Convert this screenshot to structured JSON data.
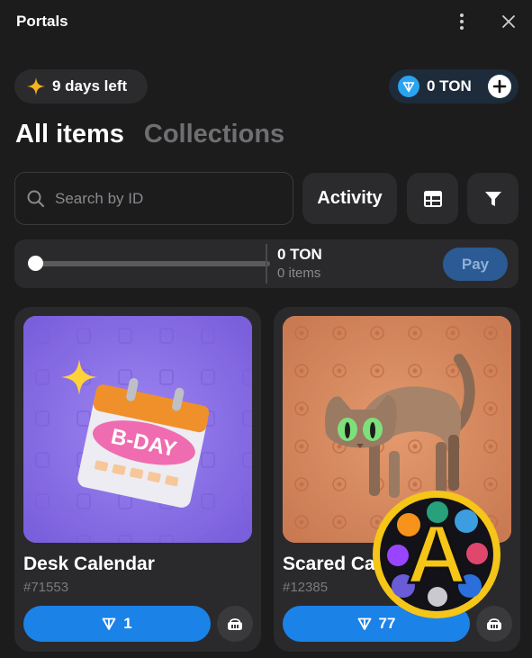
{
  "window": {
    "title": "Portals"
  },
  "header": {
    "days_left": "9 days left",
    "balance": "0 TON"
  },
  "tabs": {
    "active": "All items",
    "inactive": "Collections"
  },
  "search": {
    "placeholder": "Search by ID"
  },
  "toolbar": {
    "activity_label": "Activity"
  },
  "sweep": {
    "total": "0 TON",
    "items": "0 items",
    "pay_label": "Pay",
    "slider_value": 0
  },
  "items": [
    {
      "name": "Desk Calendar",
      "id": "#71553",
      "price": "1",
      "bg": "#8a6de8"
    },
    {
      "name": "Scared Cat",
      "name_visible": "Scared Ca",
      "id": "#12385",
      "price": "77",
      "bg": "#d98b60"
    }
  ],
  "overlay": {
    "letter": "A"
  },
  "colors": {
    "accent": "#1b82e8",
    "background": "#1c1c1d",
    "card": "#2a2a2c",
    "star": "#f5b41c",
    "ton": "#2aa3f0"
  }
}
